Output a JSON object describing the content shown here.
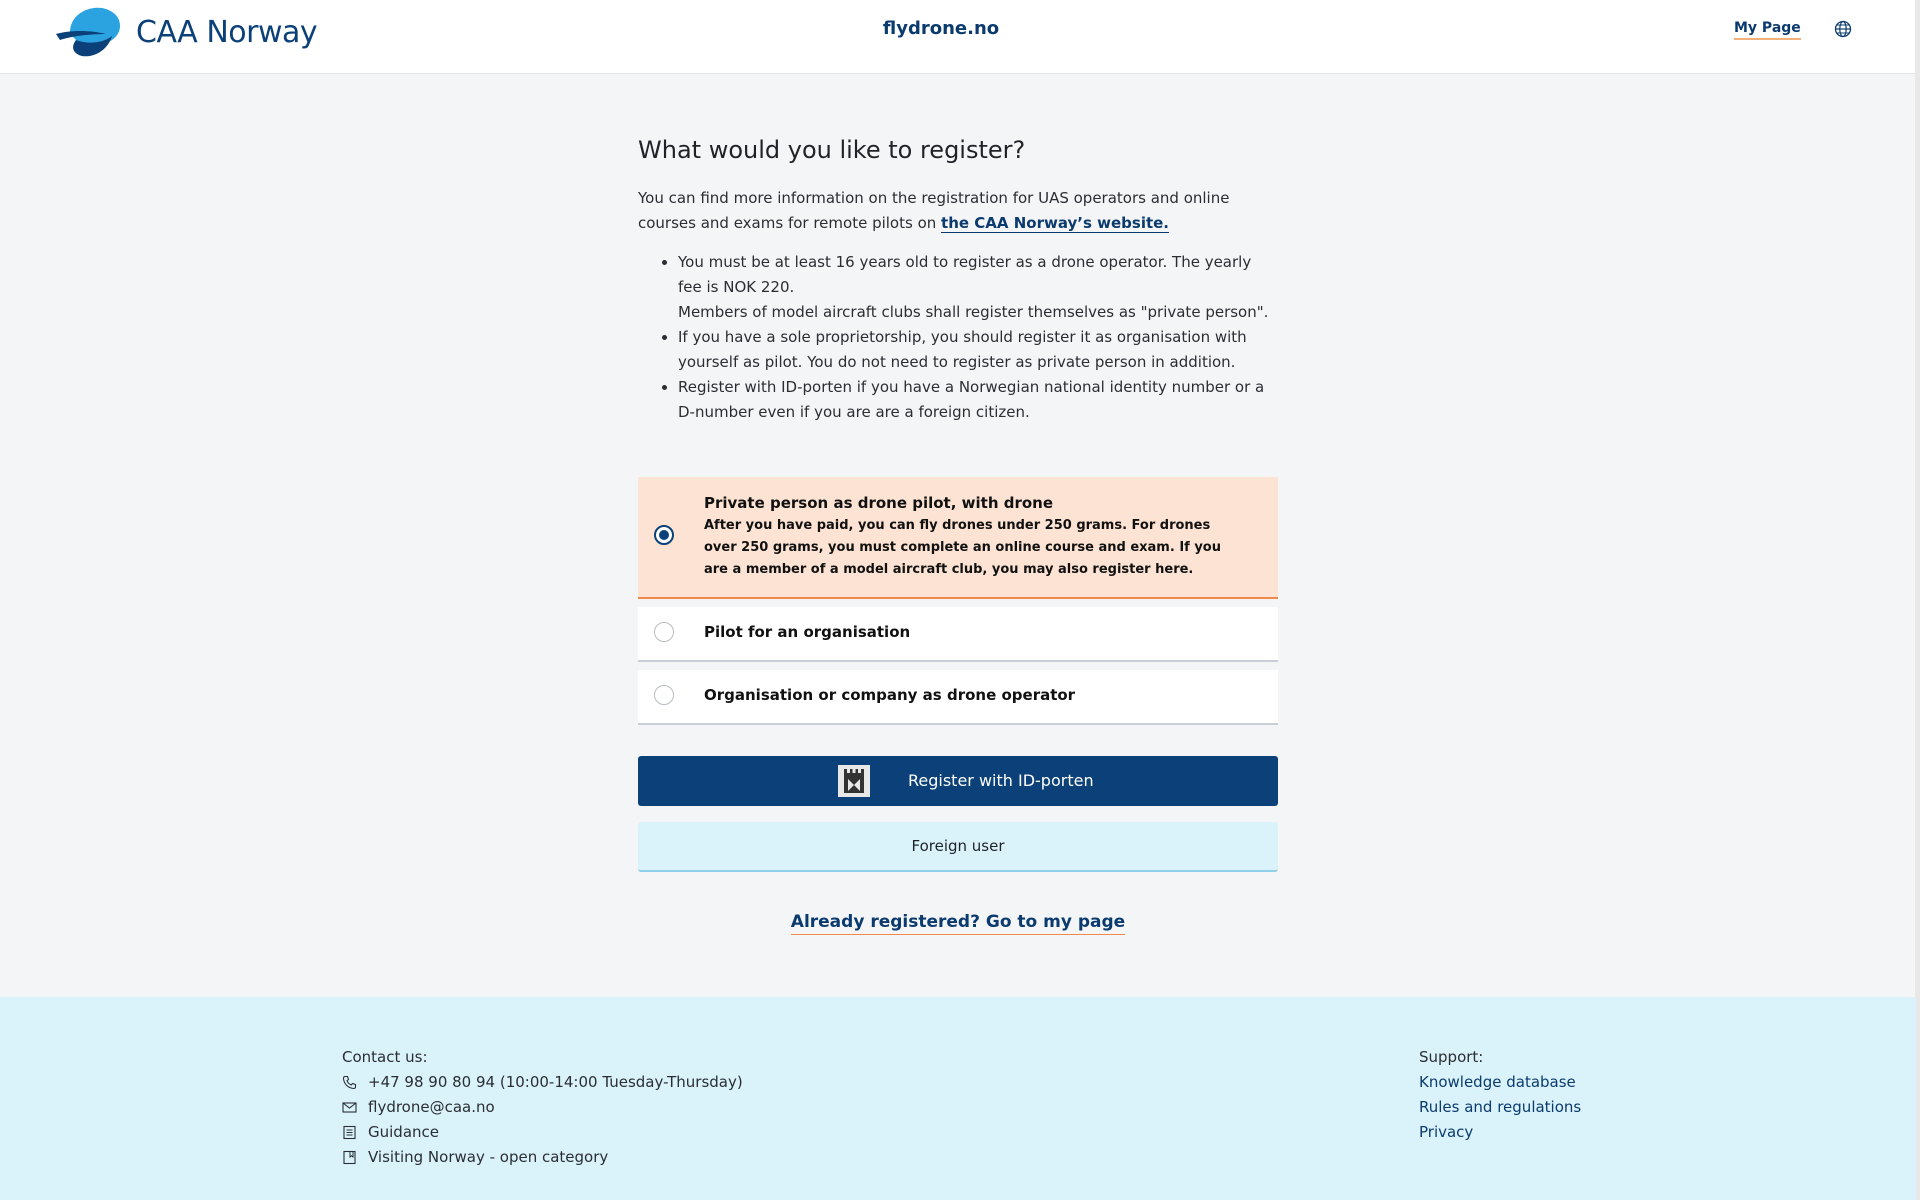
{
  "header": {
    "logo_text": "CAA Norway",
    "site_name": "flydrone.no",
    "my_page": "My Page",
    "language_icon": "globe-icon"
  },
  "main": {
    "title": "What would you like to register?",
    "intro_text": "You can find more information on the registration for UAS operators and online courses and exams for remote pilots on ",
    "intro_link": "the CAA Norway’s website.",
    "bullets": [
      {
        "line1": "You must be at least 16 years old to register as a drone operator. The yearly fee is NOK 220.",
        "line2": "Members of model aircraft clubs shall register themselves as \"private person\"."
      },
      {
        "line1": "If you have a sole proprietorship, you should register it as organisation with yourself as pilot. You do not need to register as private person in addition."
      },
      {
        "line1": "Register with ID-porten if you have a Norwegian national identity number or a D-number even if you are are a foreign citizen."
      }
    ]
  },
  "options": [
    {
      "title": "Private person as drone pilot, with drone",
      "description": "After you have paid, you can fly drones under 250 grams. For drones over 250 grams, you must complete an online course and exam. If you are a member of a model aircraft club, you may also register here.",
      "selected": true
    },
    {
      "title": "Pilot for an organisation",
      "selected": false
    },
    {
      "title": "Organisation or company as drone operator",
      "selected": false
    }
  ],
  "actions": {
    "register_idporten": "Register with ID-porten",
    "foreign_user": "Foreign user",
    "already_registered": "Already registered? Go to my page"
  },
  "footer": {
    "contact_heading": "Contact us:",
    "phone": "+47 98 90 80 94 (10:00-14:00 Tuesday-Thursday)",
    "email": "flydrone@caa.no",
    "guidance": "Guidance",
    "visiting": "Visiting Norway - open category",
    "support_heading": "Support:",
    "support_links": [
      "Knowledge database",
      "Rules and regulations",
      "Privacy"
    ]
  },
  "colors": {
    "brand": "#0b4178",
    "selected_bg": "#fde3d3",
    "accent": "#f08a4b",
    "footer_bg": "#daf3fb"
  }
}
